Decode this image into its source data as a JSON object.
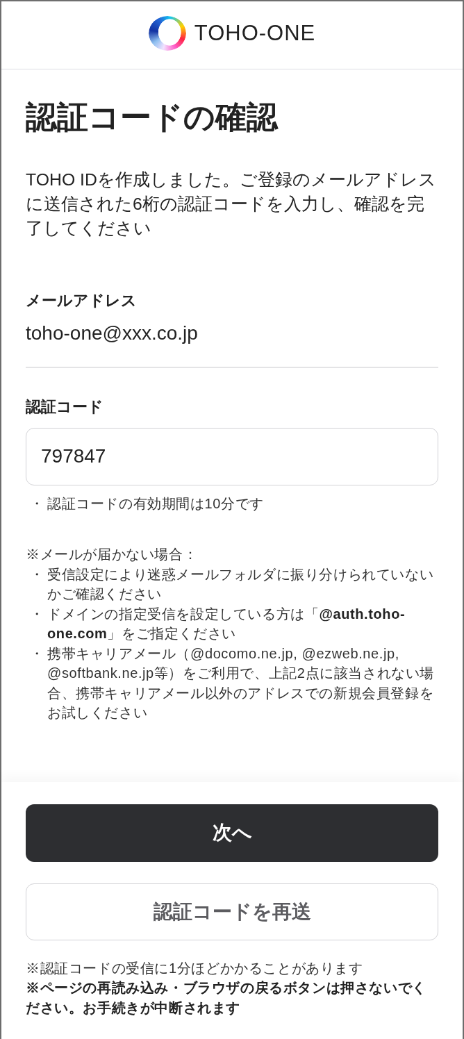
{
  "header": {
    "logo_text": "TOHO-ONE"
  },
  "title": "認証コードの確認",
  "description": "TOHO IDを作成しました。ご登録のメールアドレスに送信された6桁の認証コードを入力し、確認を完了してください",
  "email": {
    "label": "メールアドレス",
    "value": "toho-one@xxx.co.jp"
  },
  "code": {
    "label": "認証コード",
    "value": "797847",
    "hints": [
      {
        "bullet": "・",
        "text": "認証コードの有効期間は10分です"
      }
    ]
  },
  "help": {
    "heading": "※メールが届かない場合：",
    "items": [
      {
        "bullet": "・",
        "text": "受信設定により迷惑メールフォルダに振り分けられていないかご確認ください"
      },
      {
        "bullet": "・",
        "text": "ドメインの指定受信を設定している方は「**@auth.toho-one.com**」をご指定ください"
      },
      {
        "bullet": "・",
        "text": "携帯キャリアメール（@docomo.ne.jp, @ezweb.ne.jp, @softbank.ne.jp等）をご利用で、上記2点に該当されない場合、携帯キャリアメール以外のアドレスでの新規会員登録をお試しください"
      }
    ]
  },
  "footer": {
    "buttons": [
      {
        "label": "次へ",
        "kind": "primary"
      },
      {
        "label": "認証コードを再送",
        "kind": "secondary"
      }
    ],
    "notes": [
      {
        "text": "※認証コードの受信に1分ほどかかることがあります",
        "kind": "plain"
      },
      {
        "text": "※ページの再読み込み・ブラウザの戻るボタンは押さないでください。お手続きが中断されます",
        "kind": "warning"
      }
    ]
  }
}
